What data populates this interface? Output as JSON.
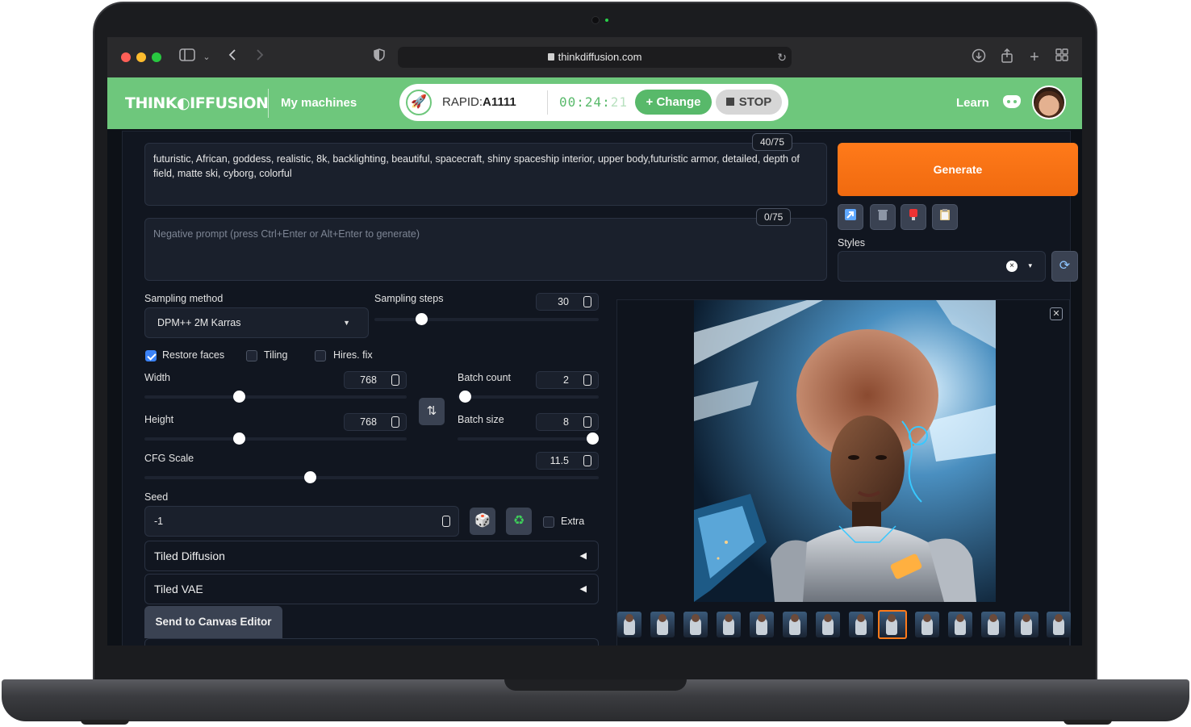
{
  "browser": {
    "url": "thinkdiffusion.com"
  },
  "header": {
    "logo": "THINK◐IFFUSION",
    "my_machines": "My machines",
    "machine_label": "RAPID:",
    "machine_name": "A1111",
    "timer_main": "00:24:",
    "timer_dim": "21",
    "change_label": "Change",
    "stop_label": "STOP",
    "learn_label": "Learn"
  },
  "prompt": {
    "text": "futuristic, African, goddess, realistic, 8k, backlighting, beautiful, spacecraft, shiny spaceship interior, upper body,futuristic  armor, detailed, depth of field, matte ski, cyborg, colorful",
    "counter": "40/75"
  },
  "negative_prompt": {
    "placeholder": "Negative prompt (press Ctrl+Enter or Alt+Enter to generate)",
    "counter": "0/75"
  },
  "generate_label": "Generate",
  "styles": {
    "label": "Styles",
    "clear": "×",
    "caret": "▾"
  },
  "sampling": {
    "method_label": "Sampling method",
    "method_value": "DPM++ 2M Karras",
    "steps_label": "Sampling steps",
    "steps_value": "30"
  },
  "checkboxes": {
    "restore_faces": "Restore faces",
    "tiling": "Tiling",
    "hires_fix": "Hires. fix",
    "extra": "Extra"
  },
  "dimensions": {
    "width_label": "Width",
    "width_value": "768",
    "height_label": "Height",
    "height_value": "768"
  },
  "batch": {
    "count_label": "Batch count",
    "count_value": "2",
    "size_label": "Batch size",
    "size_value": "8"
  },
  "cfg": {
    "label": "CFG Scale",
    "value": "11.5"
  },
  "seed": {
    "label": "Seed",
    "value": "-1"
  },
  "accordions": {
    "tiled_diffusion": "Tiled Diffusion",
    "tiled_vae": "Tiled VAE"
  },
  "canvas_button": "Send to Canvas Editor",
  "icons": {
    "arrow_left": "◀",
    "swap": "⇅",
    "dice": "🎲",
    "recycle": "♻",
    "close": "✕"
  },
  "colors": {
    "brand_green": "#6ec77c",
    "generate_orange": "#f06a0f",
    "selected_thumb": "#ff7a1a"
  }
}
